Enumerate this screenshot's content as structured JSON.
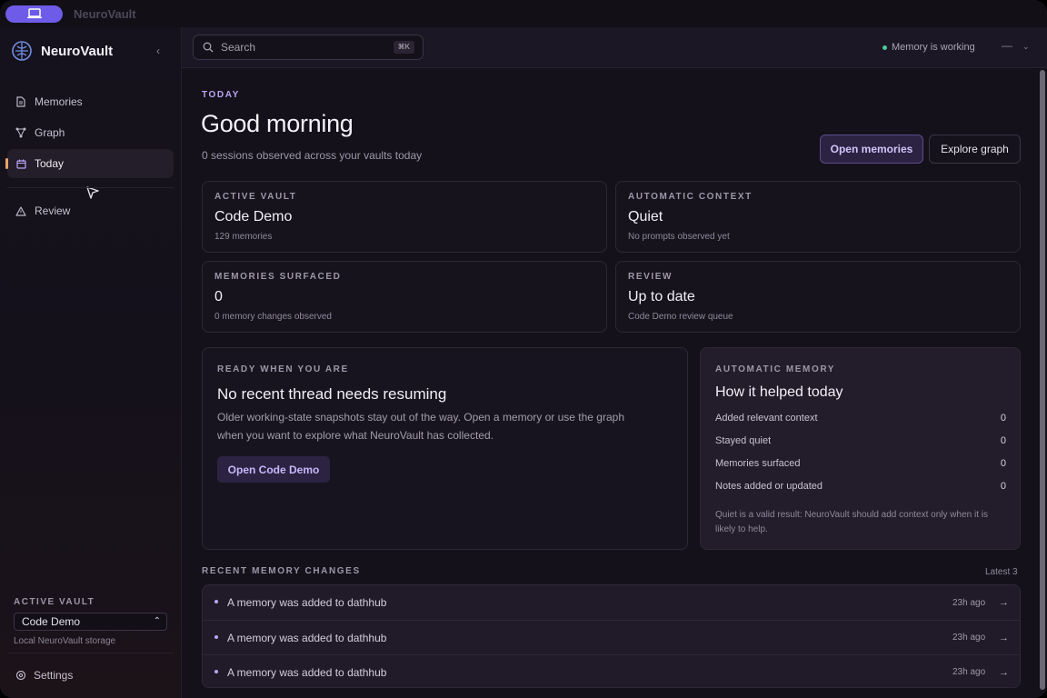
{
  "app": {
    "title": "NeuroVault",
    "brand": "NeuroVault"
  },
  "sidebar": {
    "items": [
      {
        "label": "Memories",
        "icon": "document-icon"
      },
      {
        "label": "Graph",
        "icon": "graph-icon"
      },
      {
        "label": "Today",
        "icon": "calendar-icon",
        "active": true
      },
      {
        "label": "Review",
        "icon": "warning-icon"
      }
    ],
    "active_vault_label": "ACTIVE VAULT",
    "vault_selected": "Code Demo",
    "storage": "Local NeuroVault storage",
    "settings": "Settings"
  },
  "topbar": {
    "search_placeholder": "Search",
    "search_shortcut": "⌘K",
    "status": "Memory is working",
    "status_color": "#4ec796"
  },
  "main": {
    "eyebrow": "TODAY",
    "greeting": "Good morning",
    "subtitle": "0 sessions observed across your vaults today",
    "open_memories": "Open memories",
    "explore_graph": "Explore graph",
    "stats": [
      {
        "label": "ACTIVE VAULT",
        "value": "Code Demo",
        "sub": "129 memories"
      },
      {
        "label": "AUTOMATIC CONTEXT",
        "value": "Quiet",
        "sub": "No prompts observed yet"
      },
      {
        "label": "MEMORIES SURFACED",
        "value": "0",
        "sub": "0 memory changes observed"
      },
      {
        "label": "REVIEW",
        "value": "Up to date",
        "sub": "Code Demo review queue"
      }
    ],
    "ready": {
      "label": "READY WHEN YOU ARE",
      "title": "No recent thread needs resuming",
      "body": "Older working-state snapshots stay out of the way. Open a memory or use the graph when you want to explore what NeuroVault has collected.",
      "button": "Open Code Demo"
    },
    "auto": {
      "label": "AUTOMATIC MEMORY",
      "title": "How it helped today",
      "metrics": [
        {
          "label": "Added relevant context",
          "value": "0"
        },
        {
          "label": "Stayed quiet",
          "value": "0"
        },
        {
          "label": "Memories surfaced",
          "value": "0"
        },
        {
          "label": "Notes added or updated",
          "value": "0"
        }
      ],
      "note": "Quiet is a valid result: NeuroVault should add context only when it is likely to help."
    },
    "recent": {
      "label": "RECENT MEMORY CHANGES",
      "latest": "Latest 3",
      "rows": [
        {
          "text": "A memory was added to dathhub",
          "time": "23h ago"
        },
        {
          "text": "A memory was added to dathhub",
          "time": "23h ago"
        },
        {
          "text": "A memory was added to dathhub",
          "time": "23h ago"
        }
      ]
    }
  },
  "colors": {
    "accent": "#6e5ce8",
    "accent_text": "#b9a5f5",
    "active_marker": "#e7a36a"
  }
}
